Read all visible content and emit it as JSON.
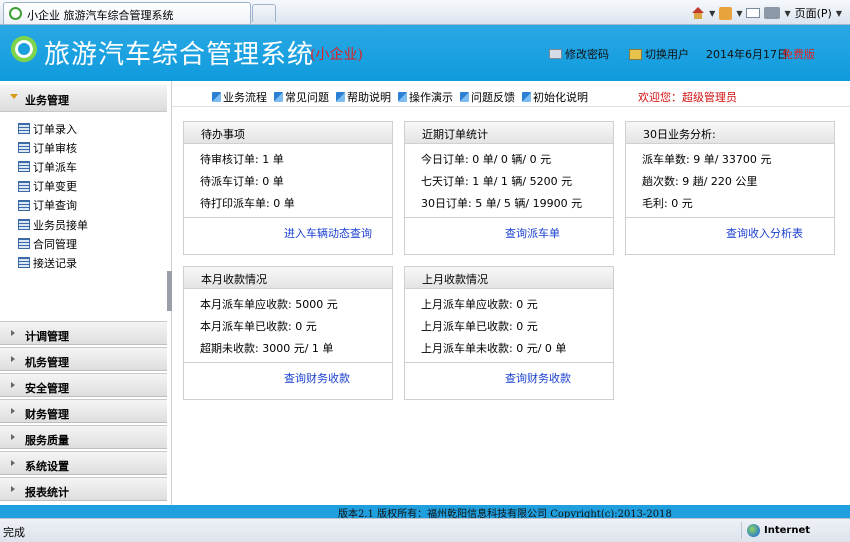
{
  "browser": {
    "tab_title": "小企业  旅游汽车综合管理系统",
    "page_menu": "页面(P)",
    "status": "完成",
    "zone": "Internet"
  },
  "header": {
    "title": "旅游汽车综合管理系统",
    "subtitle": "(小企业)",
    "change_password": "修改密码",
    "switch_user": "切换用户",
    "date": "2014年6月17日",
    "edition": "免费版"
  },
  "sidebar": {
    "active_section": "业务管理",
    "items": [
      {
        "label": "订单录入"
      },
      {
        "label": "订单审核"
      },
      {
        "label": "订单派车"
      },
      {
        "label": "订单变更"
      },
      {
        "label": "订单查询"
      },
      {
        "label": "业务员接单"
      },
      {
        "label": "合同管理"
      },
      {
        "label": "接送记录"
      }
    ],
    "sections": [
      {
        "label": "计调管理"
      },
      {
        "label": "机务管理"
      },
      {
        "label": "安全管理"
      },
      {
        "label": "财务管理"
      },
      {
        "label": "服务质量"
      },
      {
        "label": "系统设置"
      },
      {
        "label": "报表统计"
      }
    ]
  },
  "topnav": {
    "links": [
      {
        "label": "业务流程"
      },
      {
        "label": "常见问题"
      },
      {
        "label": "帮助说明"
      },
      {
        "label": "操作演示"
      },
      {
        "label": "问题反馈"
      },
      {
        "label": "初始化说明"
      }
    ],
    "welcome": "欢迎您：超级管理员"
  },
  "panels": {
    "todo": {
      "title": "待办事项",
      "lines": [
        "待审核订单: 1 单",
        "待派车订单: 0 单",
        "待打印派车单: 0 单"
      ],
      "link": "进入车辆动态查询"
    },
    "orders": {
      "title": "近期订单统计",
      "lines": [
        "今日订单: 0 单/ 0 辆/ 0  元",
        "七天订单: 1 单/ 1 辆/ 5200  元",
        "30日订单: 5 单/ 5  辆/ 19900  元"
      ],
      "link": "查询派车单"
    },
    "analysis": {
      "title": "30日业务分析:",
      "lines": [
        "派车单数: 9 单/ 33700 元",
        "趟次数: 9 趟/ 220 公里",
        "毛利: 0 元"
      ],
      "link": "查询收入分析表"
    },
    "this_month": {
      "title": "本月收款情况",
      "lines": [
        "本月派车单应收款: 5000 元",
        "本月派车单已收款: 0 元",
        "超期未收款: 3000 元/ 1 单"
      ],
      "link": "查询财务收款"
    },
    "last_month": {
      "title": "上月收款情况",
      "lines": [
        "上月派车单应收款: 0 元",
        "上月派车单已收款: 0 元",
        "上月派车单未收款: 0 元/ 0 单"
      ],
      "link": "查询财务收款"
    }
  },
  "footer": {
    "text": "版本2.1    版权所有：福州乾阳信息科技有限公司 Copyright(c):2013-2018"
  }
}
